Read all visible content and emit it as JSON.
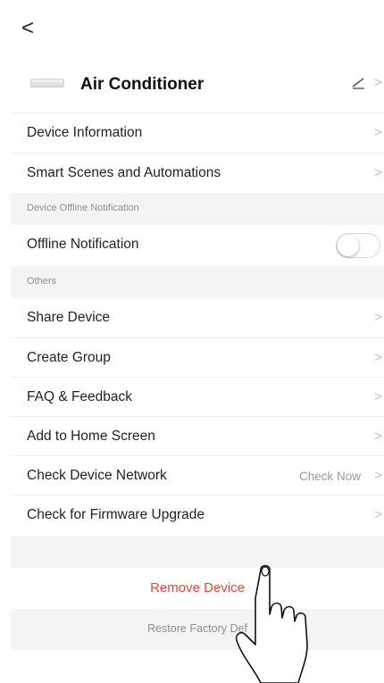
{
  "header": {
    "back_glyph": "<"
  },
  "device": {
    "name": "Air Conditioner",
    "icon": "air-conditioner-icon"
  },
  "rows": {
    "device_information": "Device Information",
    "smart_scenes": "Smart Scenes and Automations",
    "offline_notification": "Offline Notification",
    "share_device": "Share Device",
    "create_group": "Create Group",
    "faq_feedback": "FAQ & Feedback",
    "add_home_screen": "Add to Home Screen",
    "check_network": "Check Device Network",
    "check_network_value": "Check Now",
    "firmware_upgrade": "Check for Firmware Upgrade"
  },
  "sections": {
    "offline": "Device Offline Notification",
    "others": "Others"
  },
  "toggles": {
    "offline_notification_on": false
  },
  "actions": {
    "remove_device": "Remove Device",
    "restore_factory": "Restore Factory Def"
  },
  "colors": {
    "danger": "#e8453c",
    "muted": "#8e8e8e"
  }
}
